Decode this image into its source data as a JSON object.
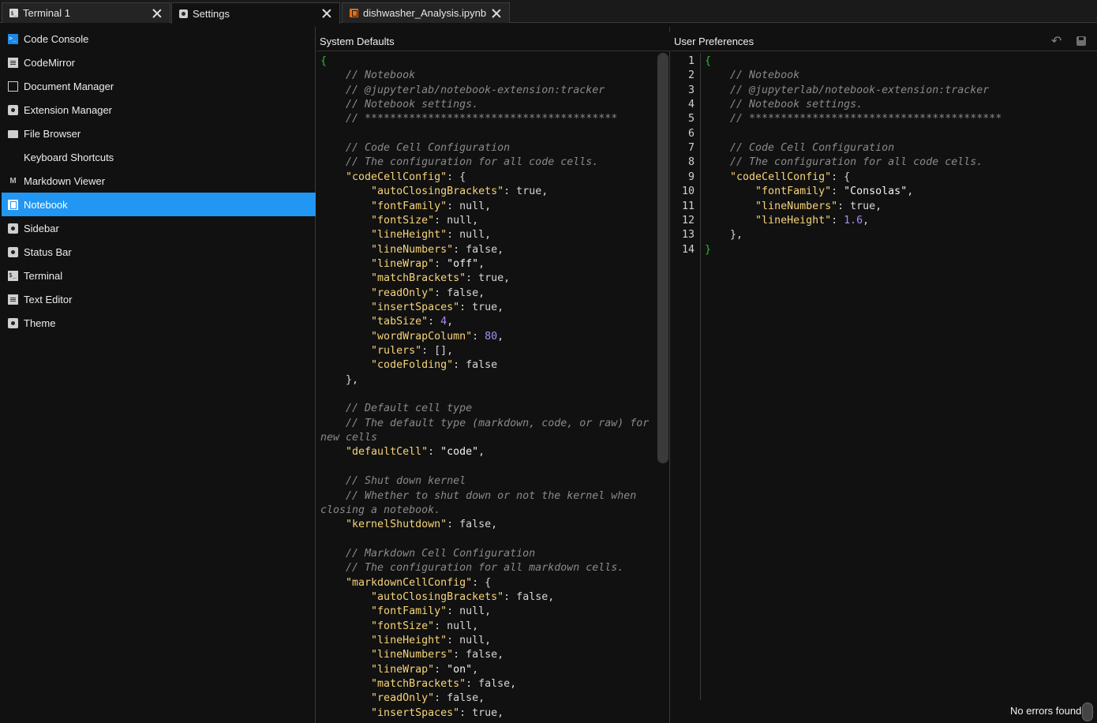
{
  "tabs": [
    {
      "label": "Terminal 1",
      "icon": "terminal-icon"
    },
    {
      "label": "Settings",
      "icon": "gear-icon",
      "active": true
    },
    {
      "label": "dishwasher_Analysis.ipynb",
      "icon": "notebook-icon"
    }
  ],
  "sidebar": {
    "items": [
      {
        "label": "Code Console",
        "icon": "console-icon"
      },
      {
        "label": "CodeMirror",
        "icon": "document-icon"
      },
      {
        "label": "Document Manager",
        "icon": "page-icon"
      },
      {
        "label": "Extension Manager",
        "icon": "gear-icon"
      },
      {
        "label": "File Browser",
        "icon": "folder-icon"
      },
      {
        "label": "Keyboard Shortcuts",
        "icon": "keyboard-icon"
      },
      {
        "label": "Markdown Viewer",
        "icon": "markdown-icon"
      },
      {
        "label": "Notebook",
        "icon": "notebook-icon",
        "selected": true
      },
      {
        "label": "Sidebar",
        "icon": "gear-icon"
      },
      {
        "label": "Status Bar",
        "icon": "gear-icon"
      },
      {
        "label": "Terminal",
        "icon": "terminal-icon"
      },
      {
        "label": "Text Editor",
        "icon": "document-icon"
      },
      {
        "label": "Theme",
        "icon": "gear-icon"
      }
    ]
  },
  "system_defaults": {
    "title": "System Defaults",
    "lines": [
      "{",
      "    // Notebook",
      "    // @jupyterlab/notebook-extension:tracker",
      "    // Notebook settings.",
      "    // ****************************************",
      "",
      "    // Code Cell Configuration",
      "    // The configuration for all code cells.",
      "    \"codeCellConfig\": {",
      "        \"autoClosingBrackets\": true,",
      "        \"fontFamily\": null,",
      "        \"fontSize\": null,",
      "        \"lineHeight\": null,",
      "        \"lineNumbers\": false,",
      "        \"lineWrap\": \"off\",",
      "        \"matchBrackets\": true,",
      "        \"readOnly\": false,",
      "        \"insertSpaces\": true,",
      "        \"tabSize\": 4,",
      "        \"wordWrapColumn\": 80,",
      "        \"rulers\": [],",
      "        \"codeFolding\": false",
      "    },",
      "",
      "    // Default cell type",
      "    // The default type (markdown, code, or raw) for",
      "new cells",
      "    \"defaultCell\": \"code\",",
      "",
      "    // Shut down kernel",
      "    // Whether to shut down or not the kernel when",
      "closing a notebook.",
      "    \"kernelShutdown\": false,",
      "",
      "    // Markdown Cell Configuration",
      "    // The configuration for all markdown cells.",
      "    \"markdownCellConfig\": {",
      "        \"autoClosingBrackets\": false,",
      "        \"fontFamily\": null,",
      "        \"fontSize\": null,",
      "        \"lineHeight\": null,",
      "        \"lineNumbers\": false,",
      "        \"lineWrap\": \"on\",",
      "        \"matchBrackets\": false,",
      "        \"readOnly\": false,",
      "        \"insertSpaces\": true,"
    ]
  },
  "user_preferences": {
    "title": "User Preferences",
    "lines": [
      "{",
      "    // Notebook",
      "    // @jupyterlab/notebook-extension:tracker",
      "    // Notebook settings.",
      "    // ****************************************",
      "",
      "    // Code Cell Configuration",
      "    // The configuration for all code cells.",
      "    \"codeCellConfig\": {",
      "        \"fontFamily\": \"Consolas\",",
      "        \"lineNumbers\": true,",
      "        \"lineHeight\": 1.6,",
      "    },",
      "}"
    ]
  },
  "status": {
    "text": "No errors found"
  },
  "colors": {
    "accent": "#2196f3",
    "key": "#f7d478",
    "comment": "#8a8a8a",
    "number": "#a98cf2",
    "brace": "#25c025",
    "notebook_orange": "#e46e1b"
  }
}
